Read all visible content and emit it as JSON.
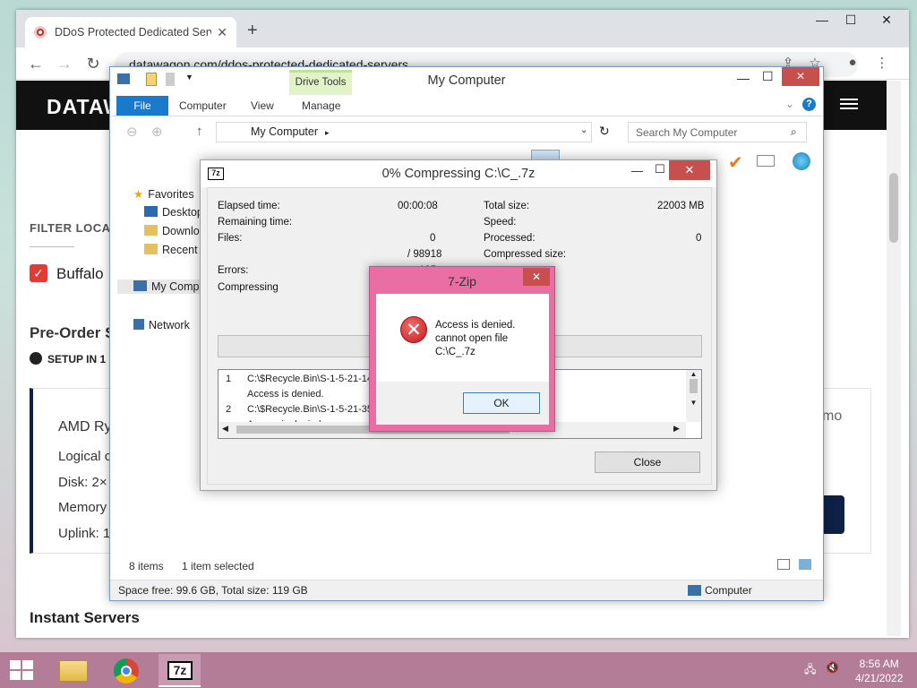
{
  "browser": {
    "tab_title": "DDoS Protected Dedicated Serve",
    "tab_close": "✕",
    "new_tab": "+",
    "url": "datawagon.com/ddos-protected-dedicated-servers",
    "window_min": "—",
    "window_max": "☐",
    "window_close": "✕"
  },
  "site": {
    "logo": "DATAW",
    "filter_label": "FILTER LOCAT",
    "location": "Buffalo",
    "preorder": "Pre-Order S",
    "setup": "SETUP IN 1",
    "card": {
      "title": "AMD Ry",
      "logical": "Logical c",
      "disk": "Disk: 2×",
      "memory": "Memory",
      "uplink": "Uplink: 1"
    },
    "demo_text": "mo",
    "instant": "Instant Servers"
  },
  "explorer": {
    "title": "My Computer",
    "drive_tools": "Drive Tools",
    "tabs": [
      "File",
      "Computer",
      "View",
      "Manage"
    ],
    "address": "My Computer",
    "search_placeholder": "Search My Computer",
    "nav": {
      "favorites": "Favorites",
      "desktop": "Desktop",
      "downloads": "Downlo",
      "recent": "Recent p",
      "my_computer": "My Comp",
      "network": "Network"
    },
    "items_count": "8 items",
    "selected": "1 item selected",
    "space": "Space free: 99.6 GB, Total size: 119 GB",
    "location_label": "Computer"
  },
  "zip": {
    "title": "0% Compressing C:\\C_.7z",
    "icon_text": "7z",
    "elapsed_label": "Elapsed time:",
    "elapsed_value": "00:00:08",
    "remaining_label": "Remaining time:",
    "files_label": "Files:",
    "files_value": "0",
    "files_total": "/ 98918",
    "errors_label": "Errors:",
    "errors_value": "135",
    "total_size_label": "Total size:",
    "total_size_value": "22003 MB",
    "speed_label": "Speed:",
    "processed_label": "Processed:",
    "processed_value": "0",
    "compressed_label": "Compressed size:",
    "status": "Compressing",
    "log": [
      {
        "num": "1",
        "path": "C:\\$Recycle.Bin\\S-1-5-21-14",
        "msg": "Access is denied."
      },
      {
        "num": "2",
        "path": "C:\\$Recycle.Bin\\S-1-5-21-35",
        "msg": "Access is denied."
      }
    ],
    "close_button": "Close"
  },
  "error_dialog": {
    "title": "7-Zip",
    "close": "✕",
    "line1": "Access is denied.",
    "line2": "cannot open file",
    "line3": "C:\\C_.7z",
    "ok": "OK"
  },
  "taskbar": {
    "time": "8:56 AM",
    "date": "4/21/2022",
    "zip_label": "7z"
  },
  "colors": {
    "file_tab": "#1979ca",
    "close_red": "#c7504f",
    "error_frame": "#e96ea4",
    "taskbar": "#b37d98",
    "site_header": "#111111"
  }
}
